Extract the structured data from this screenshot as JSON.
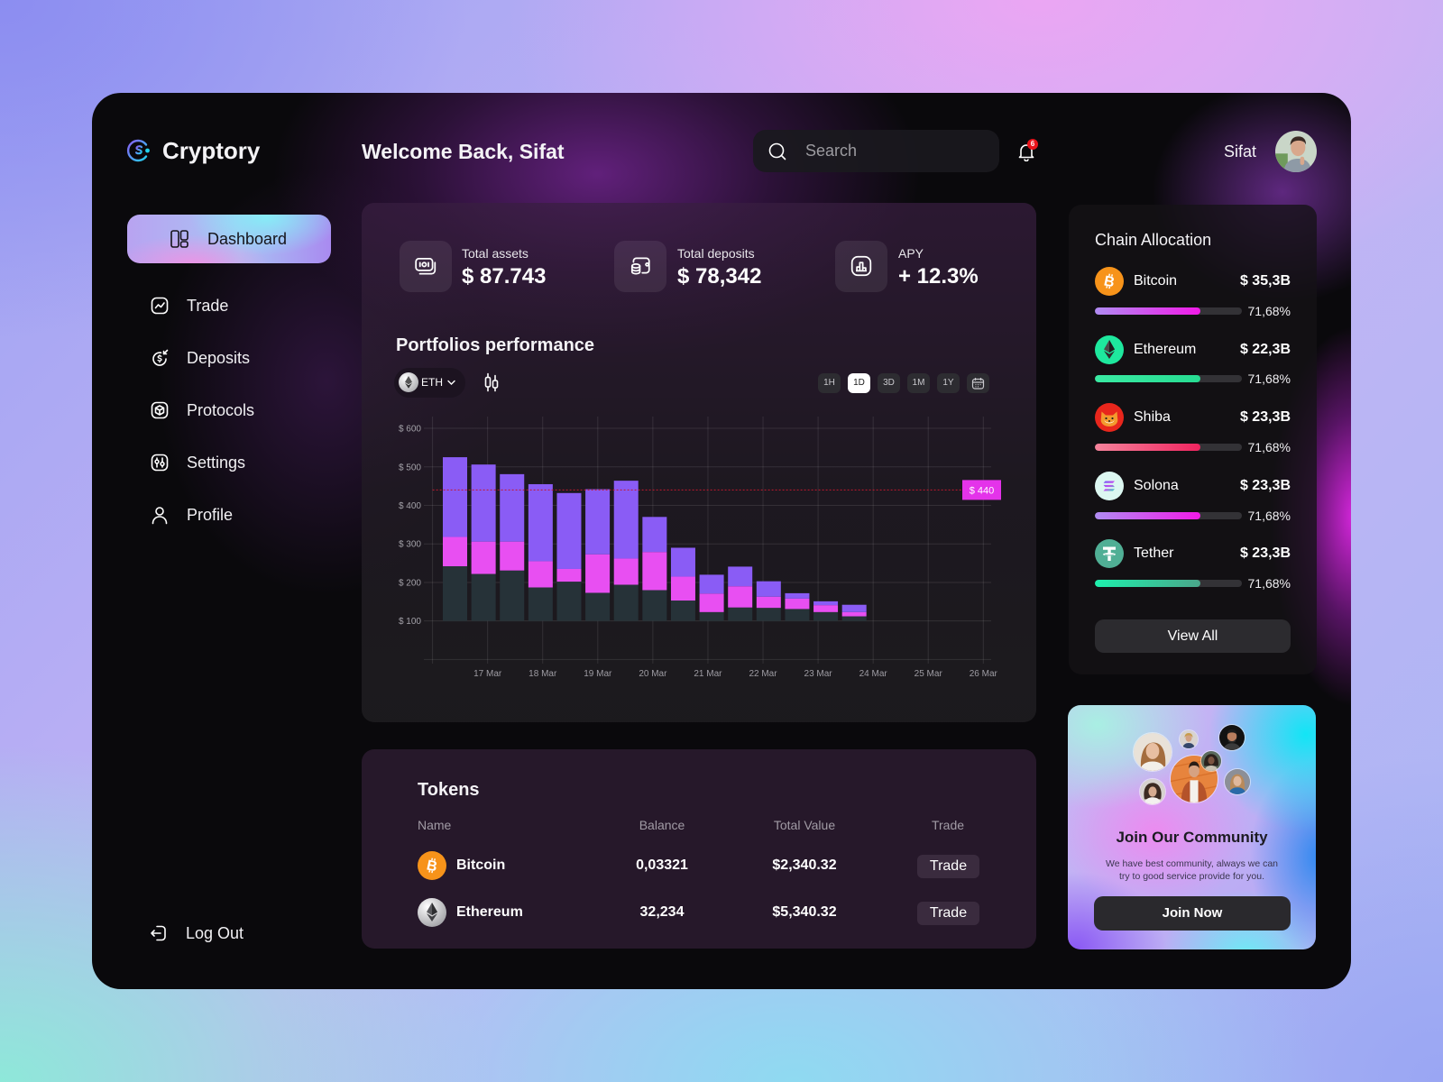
{
  "app": {
    "brand": "Cryptory",
    "welcome": "Welcome Back, Sifat"
  },
  "header": {
    "search_placeholder": "Search",
    "notification_count": "6",
    "user_name": "Sifat"
  },
  "sidebar": {
    "items": [
      {
        "label": "Dashboard",
        "icon": "dashboard-icon",
        "active": true
      },
      {
        "label": "Trade",
        "icon": "trade-icon"
      },
      {
        "label": "Deposits",
        "icon": "deposits-icon"
      },
      {
        "label": "Protocols",
        "icon": "protocols-icon"
      },
      {
        "label": "Settings",
        "icon": "settings-icon"
      },
      {
        "label": "Profile",
        "icon": "profile-icon"
      }
    ],
    "logout_label": "Log Out"
  },
  "stats": [
    {
      "label": "Total assets",
      "value": "$ 87.743",
      "icon": "banknote-icon"
    },
    {
      "label": "Total deposits",
      "value": "$ 78,342",
      "icon": "wallet-coins-icon"
    },
    {
      "label": "APY",
      "value": "+ 12.3%",
      "icon": "bar-chart-icon"
    }
  ],
  "performance": {
    "title": "Portfolios performance",
    "asset_selector": "ETH",
    "timeframes": [
      "1H",
      "1D",
      "3D",
      "1M",
      "1Y"
    ],
    "active_timeframe": "1D"
  },
  "chart_data": {
    "type": "bar",
    "stacked": true,
    "title": "Portfolios performance",
    "xlabel": "",
    "ylabel": "",
    "ylim": [
      0,
      600
    ],
    "baseline": 100,
    "yticks": [
      600,
      500,
      400,
      300,
      200,
      100
    ],
    "ytick_labels": [
      "$ 600",
      "$ 500",
      "$ 400",
      "$ 300",
      "$ 200",
      "$ 100"
    ],
    "x_tick_labels": [
      "17 Mar",
      "18 Mar",
      "19 Mar",
      "20 Mar",
      "21 Mar",
      "22 Mar",
      "23 Mar",
      "24 Mar",
      "25 Mar",
      "26 Mar"
    ],
    "grid": true,
    "legend": "none",
    "series": [
      {
        "key": "base",
        "color": "#263238",
        "values": [
          142,
          122,
          131,
          87,
          102,
          73,
          94,
          80,
          53,
          23,
          35,
          34,
          31,
          23,
          12
        ]
      },
      {
        "key": "middle",
        "color": "#e84ff2",
        "values": [
          76,
          84,
          75,
          68,
          33,
          100,
          68,
          99,
          62,
          48,
          55,
          29,
          27,
          18,
          11
        ]
      },
      {
        "key": "top",
        "color": "#8a5cf5",
        "values": [
          207,
          200,
          175,
          200,
          197,
          169,
          202,
          91,
          75,
          49,
          51,
          40,
          14,
          10,
          19
        ]
      }
    ],
    "reference_line": {
      "value": 440,
      "label": "$ 440",
      "line_color": "#c3182e",
      "label_color": "#e433ea"
    }
  },
  "tokens": {
    "title": "Tokens",
    "columns": [
      "Name",
      "Balance",
      "Total Value",
      "Trade"
    ],
    "rows": [
      {
        "name": "Bitcoin",
        "balance": "0,03321",
        "total_value": "$2,340.32",
        "action": "Trade",
        "icon": "bitcoin-icon"
      },
      {
        "name": "Ethereum",
        "balance": "32,234",
        "total_value": "$5,340.32",
        "action": "Trade",
        "icon": "ethereum-icon"
      }
    ]
  },
  "chain_allocation": {
    "title": "Chain Allocation",
    "items": [
      {
        "name": "Bitcoin",
        "value": "$ 35,3B",
        "percent_label": "71,68%",
        "percent": 71.68,
        "icon": "bitcoin-icon",
        "bar_colors": [
          "#b08cf3",
          "#f21ae8"
        ]
      },
      {
        "name": "Ethereum",
        "value": "$ 22,3B",
        "percent_label": "71,68%",
        "percent": 71.68,
        "icon": "ethereum-icon",
        "bar_colors": [
          "#3aeaa3",
          "#27dc92"
        ]
      },
      {
        "name": "Shiba",
        "value": "$ 23,3B",
        "percent_label": "71,68%",
        "percent": 71.68,
        "icon": "shiba-icon",
        "bar_colors": [
          "#f5839b",
          "#f0245f"
        ]
      },
      {
        "name": "Solona",
        "value": "$ 23,3B",
        "percent_label": "71,68%",
        "percent": 71.68,
        "icon": "solana-icon",
        "bar_colors": [
          "#b08cf3",
          "#f21ae8"
        ]
      },
      {
        "name": "Tether",
        "value": "$ 23,3B",
        "percent_label": "71,68%",
        "percent": 71.68,
        "icon": "tether-icon",
        "bar_colors": [
          "#1ef0ad",
          "#4aa68a"
        ]
      }
    ],
    "view_all_label": "View All"
  },
  "community": {
    "title": "Join Our Community",
    "description_lines": [
      "We have best community, always we can",
      "try to good service provide for you."
    ],
    "button_label": "Join Now"
  }
}
